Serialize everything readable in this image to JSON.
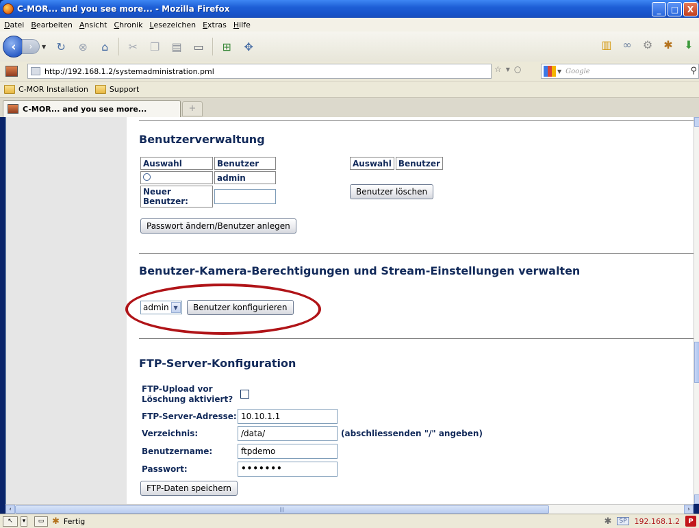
{
  "window": {
    "title": "C-MOR... and you see more... - Mozilla Firefox",
    "minimize": "_",
    "maximize": "□",
    "close": "X"
  },
  "menu": [
    "Datei",
    "Bearbeiten",
    "Ansicht",
    "Chronik",
    "Lesezeichen",
    "Extras",
    "Hilfe"
  ],
  "urlbar": {
    "url": "http://192.168.1.2/systemadministration.pml",
    "search_placeholder": "Google"
  },
  "bookmarks": [
    "C-MOR Installation",
    "Support"
  ],
  "tab": {
    "label": "C-MOR... and you see more...",
    "newtab": "+"
  },
  "user_admin": {
    "heading": "Benutzerverwaltung",
    "col_select": "Auswahl",
    "col_user": "Benutzer",
    "row_user": "admin",
    "new_user_label": "Neuer Benutzer:",
    "new_user_value": "",
    "change_button": "Passwort ändern/Benutzer anlegen",
    "right_col_select": "Auswahl",
    "right_col_user": "Benutzer",
    "delete_button": "Benutzer löschen"
  },
  "camera_perm": {
    "heading": "Benutzer-Kamera-Berechtigungen und Stream-Einstellungen verwalten",
    "selected_user": "admin",
    "configure_button": "Benutzer konfigurieren"
  },
  "ftp": {
    "heading": "FTP-Server-Konfiguration",
    "upload_label_line1": "FTP-Upload vor",
    "upload_label_line2": "Löschung aktiviert?",
    "server_label": "FTP-Server-Adresse:",
    "server_value": "10.10.1.1",
    "dir_label": "Verzeichnis:",
    "dir_value": "/data/",
    "dir_hint": "(abschliessenden \"/\" angeben)",
    "user_label": "Benutzername:",
    "user_value": "ftpdemo",
    "pass_label": "Passwort:",
    "pass_value": "•••••••",
    "save_button": "FTP-Daten speichern"
  },
  "status": {
    "text": "Fertig",
    "sp": "SP",
    "ip": "192.168.1.2",
    "badge": "P"
  }
}
